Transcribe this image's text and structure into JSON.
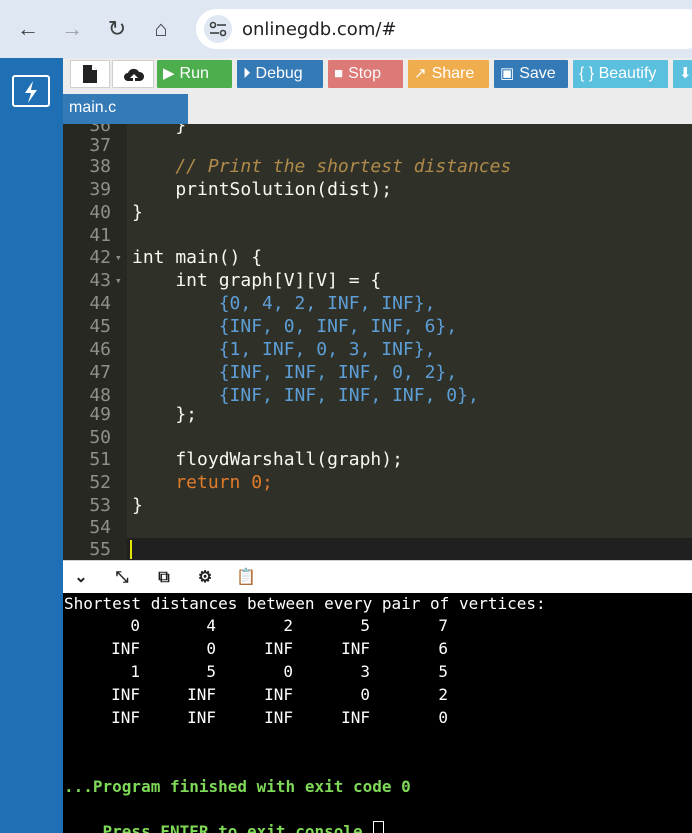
{
  "browser": {
    "url": "onlinegdb.com/#",
    "back_icon": "←",
    "forward_icon": "→",
    "reload_icon": "↻",
    "home_icon": "⌂"
  },
  "toolbar": {
    "new_file_icon": "file-icon",
    "upload_icon": "cloud-upload-icon",
    "run_label": "Run",
    "debug_label": "Debug",
    "stop_label": "Stop",
    "share_label": "Share",
    "save_label": "Save",
    "beautify_label": "{ } Beautify"
  },
  "tab": {
    "label": "main.c"
  },
  "editor": {
    "lines": [
      {
        "n": "36",
        "code": "    }"
      },
      {
        "n": "37",
        "code": ""
      },
      {
        "n": "38",
        "code": "    // Print the shortest distances"
      },
      {
        "n": "39",
        "code": "    printSolution(dist);"
      },
      {
        "n": "40",
        "code": "}"
      },
      {
        "n": "41",
        "code": ""
      },
      {
        "n": "42",
        "code": "int main() {"
      },
      {
        "n": "43",
        "code": "    int graph[V][V] = {"
      },
      {
        "n": "44",
        "code": "        {0, 4, 2, INF, INF},"
      },
      {
        "n": "45",
        "code": "        {INF, 0, INF, INF, 6},"
      },
      {
        "n": "46",
        "code": "        {1, INF, 0, 3, INF},"
      },
      {
        "n": "47",
        "code": "        {INF, INF, INF, 0, 2},"
      },
      {
        "n": "48",
        "code": "        {INF, INF, INF, INF, 0},"
      },
      {
        "n": "49",
        "code": "    };"
      },
      {
        "n": "50",
        "code": ""
      },
      {
        "n": "51",
        "code": "    floydWarshall(graph);"
      },
      {
        "n": "52",
        "code": "    return 0;"
      },
      {
        "n": "53",
        "code": "}"
      },
      {
        "n": "54",
        "code": ""
      },
      {
        "n": "55",
        "code": ""
      }
    ],
    "fold_marker": "▾"
  },
  "console": {
    "heading": "Shortest distances between every pair of vertices:",
    "rows": [
      [
        "0",
        "4",
        "2",
        "5",
        "7"
      ],
      [
        "INF",
        "0",
        "INF",
        "INF",
        "6"
      ],
      [
        "1",
        "5",
        "0",
        "3",
        "5"
      ],
      [
        "INF",
        "INF",
        "INF",
        "0",
        "2"
      ],
      [
        "INF",
        "INF",
        "INF",
        "INF",
        "0"
      ]
    ],
    "exit_message": "...Program finished with exit code 0",
    "prompt": "Press ENTER to exit console."
  },
  "colors": {
    "rail": "#1e6fb4",
    "run": "#4cae4c",
    "debug": "#337ab7",
    "stop": "#d9534f",
    "share": "#f0ad4e",
    "beautify": "#5bc0de",
    "editor_bg": "#2f3129",
    "console_bg": "#000000",
    "exit_text": "#7ed957"
  }
}
